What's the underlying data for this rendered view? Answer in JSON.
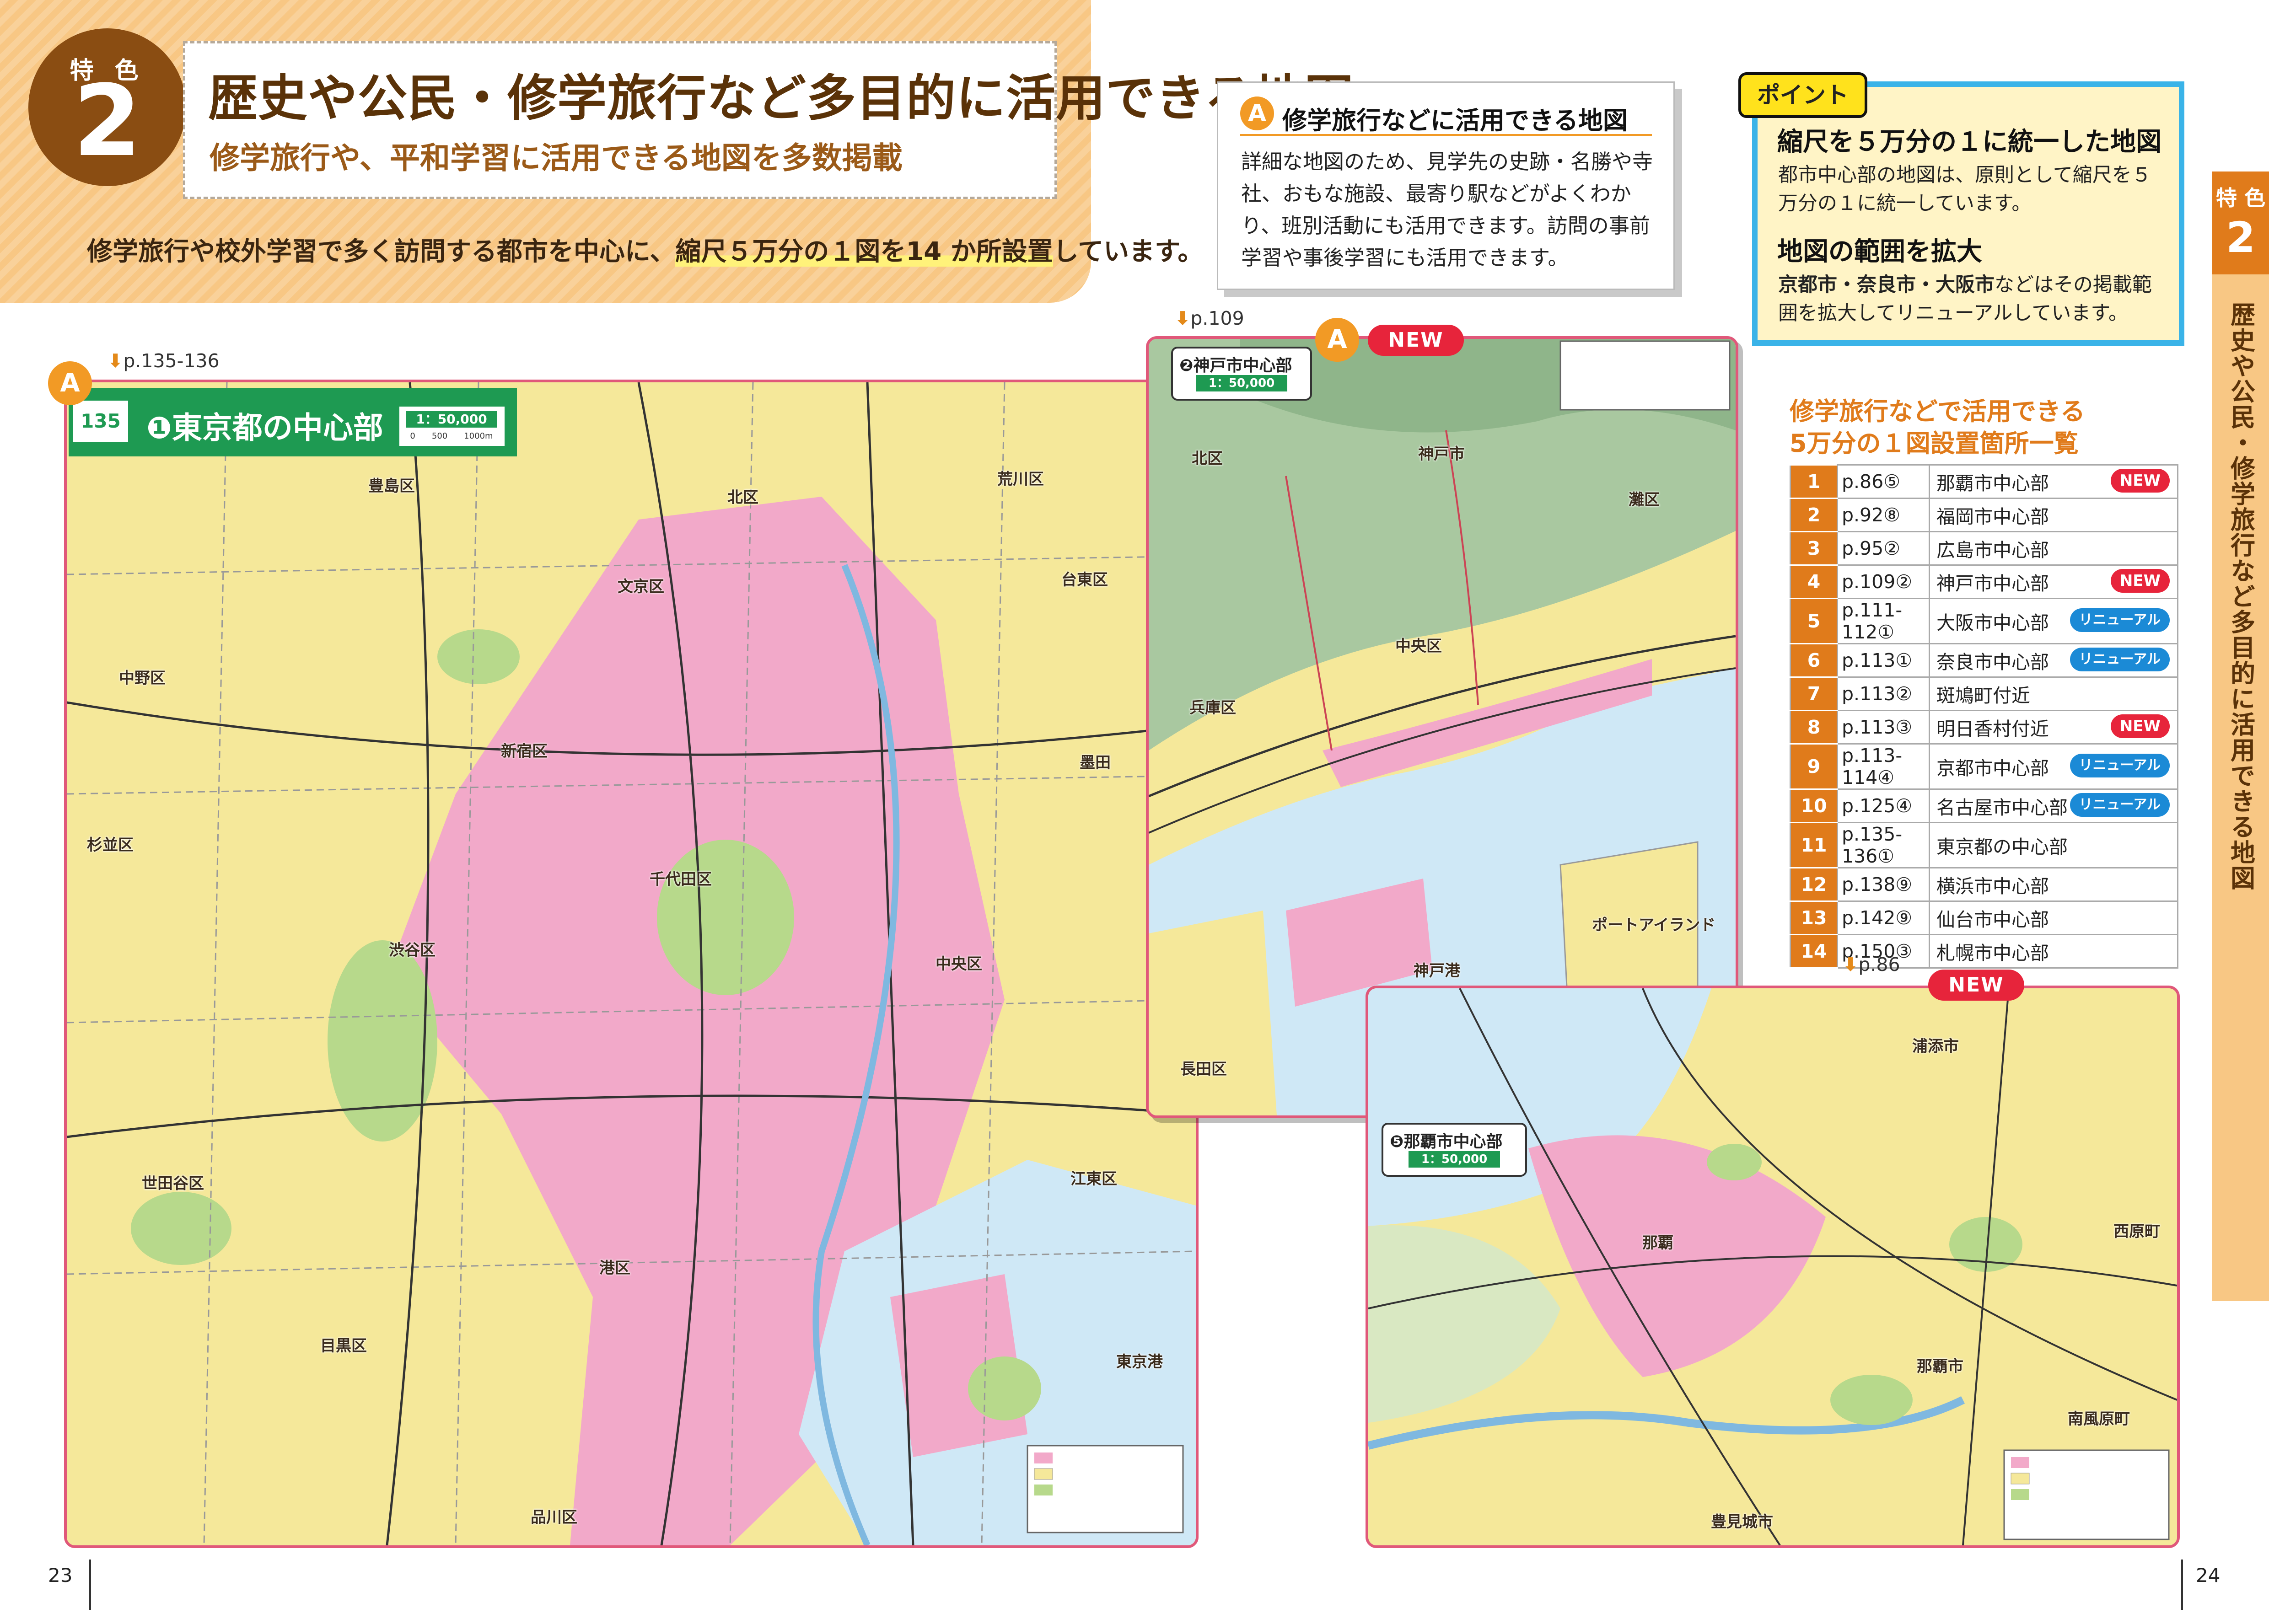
{
  "feature": {
    "label": "特 色",
    "number": "2",
    "title": "歴史や公民・修学旅行など多目的に活用できる地図",
    "subtitle": "修学旅行や、平和学習に活用できる地図を多数掲載",
    "intro_pre": "修学旅行や校外学習で多く訪問する都市を中心に、",
    "intro_hl": "縮尺５万分の１図を14 か所設置",
    "intro_post": "しています。"
  },
  "boxA": {
    "marker": "A",
    "title": "修学旅行などに活用できる地図",
    "body": "詳細な地図のため、見学先の史跡・名勝や寺社、おもな施設、最寄り駅などがよくわかり、班別活動にも活用できます。訪問の事前学習や事後学習にも活用できます。"
  },
  "point": {
    "tag": "ポイント",
    "h1": "縮尺を５万分の１に統一した地図",
    "b1": "都市中心部の地図は、原則として縮尺を５万分の１に統一しています。",
    "h2": "地図の範囲を拡大",
    "b2_bold": "京都市・奈良市・大阪市",
    "b2": "などはその掲載範囲を拡大してリニューアルしています。"
  },
  "sidetab": {
    "label": "特 色",
    "number": "2",
    "text": "歴史や公民・修学旅行など多目的に活用できる地図"
  },
  "list": {
    "title_line1": "修学旅行などで活用できる",
    "title_line2": "5万分の１図設置箇所一覧",
    "rows": [
      {
        "n": "1",
        "page": "p.86⑤",
        "city": "那覇市中心部",
        "tag": "NEW"
      },
      {
        "n": "2",
        "page": "p.92⑧",
        "city": "福岡市中心部",
        "tag": ""
      },
      {
        "n": "3",
        "page": "p.95②",
        "city": "広島市中心部",
        "tag": ""
      },
      {
        "n": "4",
        "page": "p.109②",
        "city": "神戸市中心部",
        "tag": "NEW"
      },
      {
        "n": "5",
        "page": "p.111-112①",
        "city": "大阪市中心部",
        "tag": "リニューアル"
      },
      {
        "n": "6",
        "page": "p.113①",
        "city": "奈良市中心部",
        "tag": "リニューアル"
      },
      {
        "n": "7",
        "page": "p.113②",
        "city": "斑鳩町付近",
        "tag": ""
      },
      {
        "n": "8",
        "page": "p.113③",
        "city": "明日香村付近",
        "tag": "NEW"
      },
      {
        "n": "9",
        "page": "p.113-114④",
        "city": "京都市中心部",
        "tag": "リニューアル"
      },
      {
        "n": "10",
        "page": "p.125④",
        "city": "名古屋市中心部",
        "tag": "リニューアル"
      },
      {
        "n": "11",
        "page": "p.135-136①",
        "city": "東京都の中心部",
        "tag": ""
      },
      {
        "n": "12",
        "page": "p.138⑨",
        "city": "横浜市中心部",
        "tag": ""
      },
      {
        "n": "13",
        "page": "p.142⑨",
        "city": "仙台市中心部",
        "tag": ""
      },
      {
        "n": "14",
        "page": "p.150③",
        "city": "札幌市中心部",
        "tag": ""
      }
    ]
  },
  "maps": {
    "tokyo": {
      "ref": "p.135-136",
      "marker": "A",
      "page": "135",
      "name": "❶東京都の中心部",
      "scale": "1：50,000",
      "scale_ticks": "0　　500　　1000m",
      "wards": [
        "北区",
        "荒川区",
        "豊島区",
        "文京区",
        "台東区",
        "中野区",
        "新宿区",
        "杉並区",
        "千代田区",
        "中央区",
        "渋谷区",
        "港区",
        "世田谷区",
        "目黒区",
        "品川区",
        "江東区",
        "墨田",
        "東京港"
      ]
    },
    "kobe": {
      "ref": "p.109",
      "marker": "A",
      "tag": "NEW",
      "name": "❷神戸市中心部",
      "scale": "1：50,000",
      "wards": [
        "北区",
        "神戸市",
        "灘区",
        "中央区",
        "兵庫区",
        "長田区",
        "神戸港",
        "ポートアイランド"
      ]
    },
    "naha": {
      "ref": "p.86",
      "tag": "NEW",
      "name": "❺那覇市中心部",
      "scale": "1：50,000",
      "wards": [
        "浦添市",
        "那覇市",
        "那覇",
        "豊見城市",
        "南風原町",
        "西原町"
      ]
    }
  },
  "pages": {
    "left": "23",
    "right": "24"
  },
  "colors": {
    "banner": "#f8c784",
    "brown": "#8a4d12",
    "orange": "#e07b1b",
    "point_border": "#3ab3e8",
    "new": "#e7243b",
    "renewal": "#1b8ad6",
    "map_border": "#e0587a",
    "urban_pink": "#f2a9c9",
    "residential": "#f5e89a",
    "green": "#b7d98b",
    "water": "#cfe8f6"
  }
}
